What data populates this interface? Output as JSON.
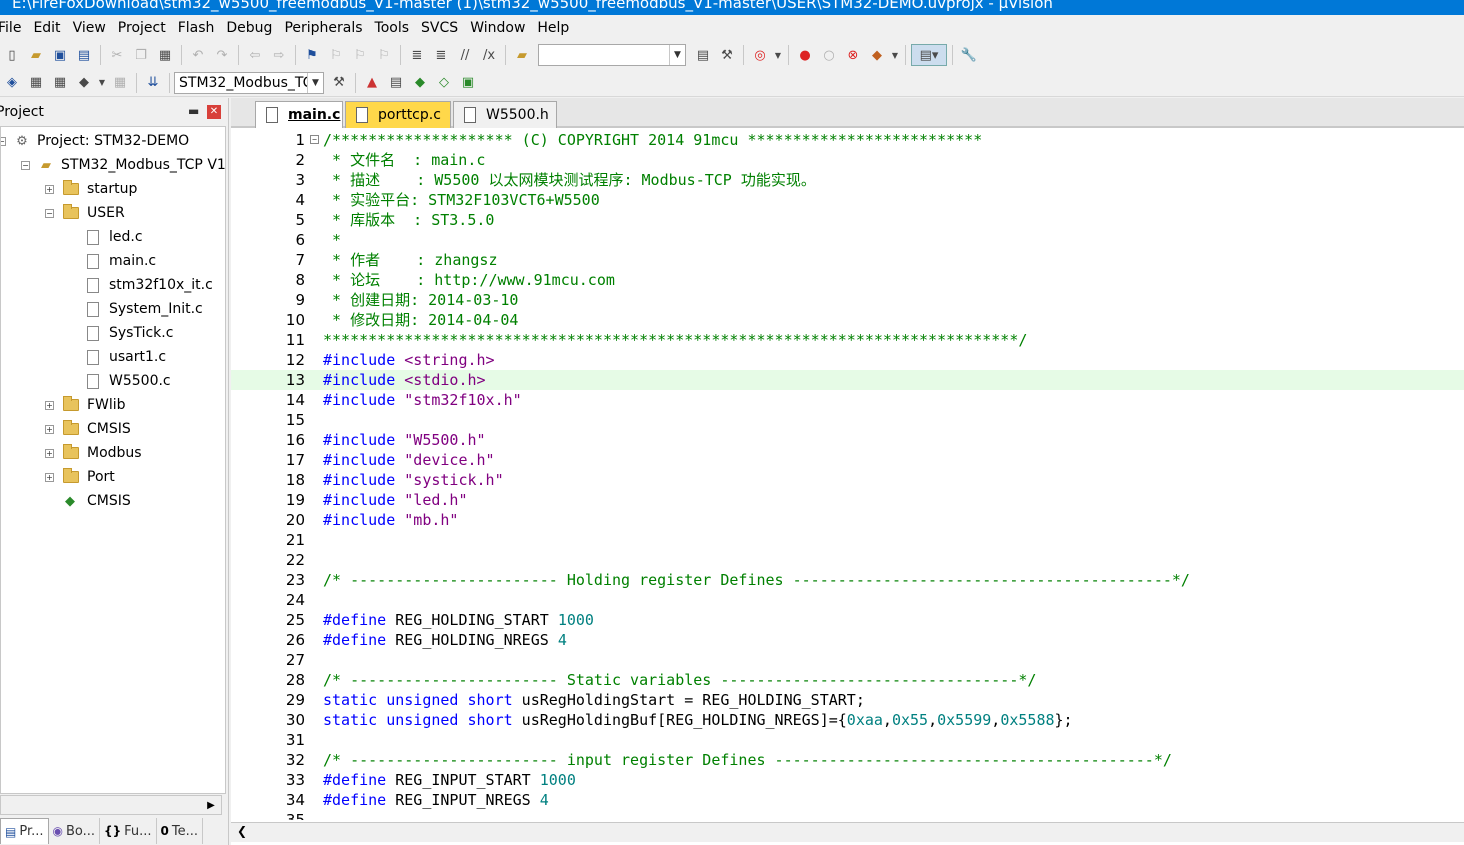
{
  "window": {
    "title": "E:\\FireFoxDownload\\stm32_w5500_freemodbus_V1-master (1)\\stm32_w5500_freemodbus_V1-master\\USER\\STM32-DEMO.uvprojx - µVision"
  },
  "menu": [
    "File",
    "Edit",
    "View",
    "Project",
    "Flash",
    "Debug",
    "Peripherals",
    "Tools",
    "SVCS",
    "Window",
    "Help"
  ],
  "toolbar": {
    "target_combo": "STM32_Modbus_TC"
  },
  "project_panel": {
    "title": "Project",
    "root": "Project: STM32-DEMO",
    "target": "STM32_Modbus_TCP V1.",
    "groups": [
      {
        "name": "startup"
      },
      {
        "name": "USER",
        "files": [
          "led.c",
          "main.c",
          "stm32f10x_it.c",
          "System_Init.c",
          "SysTick.c",
          "usart1.c",
          "W5500.c"
        ]
      },
      {
        "name": "FWlib"
      },
      {
        "name": "CMSIS"
      },
      {
        "name": "Modbus"
      },
      {
        "name": "Port"
      },
      {
        "name": "CMSIS"
      }
    ],
    "bottom_tabs": [
      "Pr...",
      "Bo...",
      "Fu...",
      "Te..."
    ]
  },
  "editor": {
    "tabs": [
      "main.c",
      "porttcp.c",
      "W5500.h"
    ],
    "active_tab": "main.c",
    "highlighted_line": 13,
    "lines": [
      {
        "n": "1",
        "t": "/******************** (C) COPYRIGHT 2014 91mcu **************************"
      },
      {
        "n": "2",
        "t": " * 文件名  : main.c"
      },
      {
        "n": "3",
        "t": " * 描述    : W5500 以太网模块测试程序: Modbus-TCP 功能实现。"
      },
      {
        "n": "4",
        "t": " * 实验平台: STM32F103VCT6+W5500"
      },
      {
        "n": "5",
        "t": " * 库版本  : ST3.5.0"
      },
      {
        "n": "6",
        "t": " *"
      },
      {
        "n": "7",
        "t": " * 作者    : zhangsz"
      },
      {
        "n": "8",
        "t": " * 论坛    : http://www.91mcu.com"
      },
      {
        "n": "9",
        "t": " * 创建日期: 2014-03-10"
      },
      {
        "n": "10",
        "t": " * 修改日期: 2014-04-04"
      },
      {
        "n": "11",
        "t": "*****************************************************************************/"
      },
      {
        "n": "12",
        "t": "#include <string.h>"
      },
      {
        "n": "13",
        "t": "#include <stdio.h>"
      },
      {
        "n": "14",
        "t": "#include \"stm32f10x.h\""
      },
      {
        "n": "15",
        "t": ""
      },
      {
        "n": "16",
        "t": "#include \"W5500.h\""
      },
      {
        "n": "17",
        "t": "#include \"device.h\""
      },
      {
        "n": "18",
        "t": "#include \"systick.h\""
      },
      {
        "n": "19",
        "t": "#include \"led.h\""
      },
      {
        "n": "20",
        "t": "#include \"mb.h\""
      },
      {
        "n": "21",
        "t": ""
      },
      {
        "n": "22",
        "t": ""
      },
      {
        "n": "23",
        "t": "/* ----------------------- Holding register Defines ------------------------------------------*/"
      },
      {
        "n": "24",
        "t": ""
      },
      {
        "n": "25",
        "t": "#define REG_HOLDING_START 1000"
      },
      {
        "n": "26",
        "t": "#define REG_HOLDING_NREGS 4"
      },
      {
        "n": "27",
        "t": ""
      },
      {
        "n": "28",
        "t": "/* ----------------------- Static variables ---------------------------------*/"
      },
      {
        "n": "29",
        "t": "static unsigned short usRegHoldingStart = REG_HOLDING_START;"
      },
      {
        "n": "30",
        "t": "static unsigned short usRegHoldingBuf[REG_HOLDING_NREGS]={0xaa,0x55,0x5599,0x5588};"
      },
      {
        "n": "31",
        "t": ""
      },
      {
        "n": "32",
        "t": "/* ----------------------- input register Defines ------------------------------------------*/"
      },
      {
        "n": "33",
        "t": "#define REG_INPUT_START 1000"
      },
      {
        "n": "34",
        "t": "#define REG_INPUT_NREGS 4"
      },
      {
        "n": "35",
        "t": ""
      }
    ]
  },
  "colors": {
    "comment": "#008000",
    "preprocessor": "#0000ff",
    "include_path": "#800080",
    "keyword": "#0000ff",
    "number": "#008080",
    "title_bar": "#0078d7",
    "active_line": "#e6fbe6"
  }
}
